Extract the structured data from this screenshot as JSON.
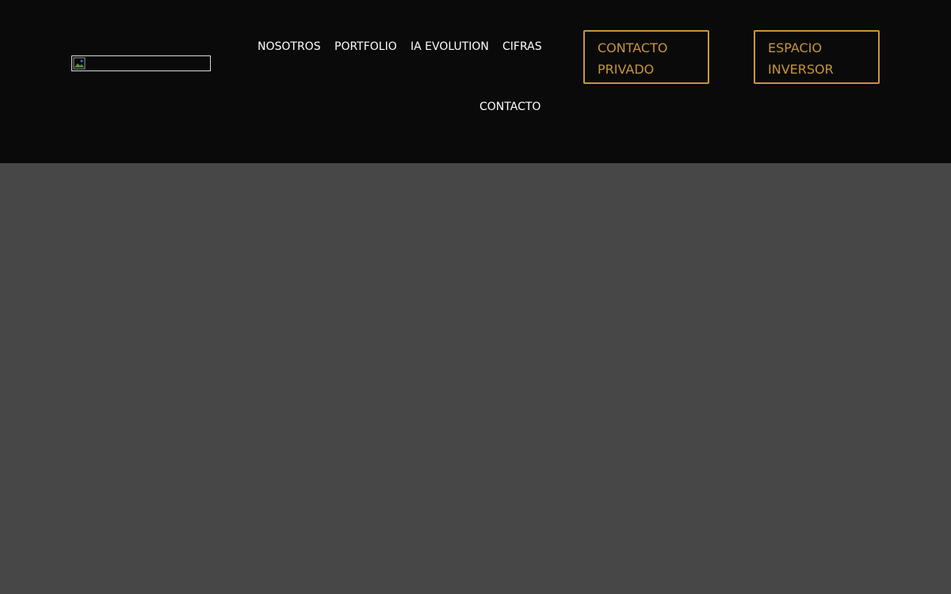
{
  "header": {
    "logo_icon": "broken-image-icon",
    "nav": {
      "nosotros": "NOSOTROS",
      "portfolio": "PORTFOLIO",
      "ia_evolution": "IA EVOLUTION",
      "cifras": "CIFRAS",
      "contacto": "CONTACTO"
    },
    "buttons": {
      "contacto_privado": "CONTACTO PRIVADO",
      "espacio_inversor": "ESPACIO INVERSOR"
    }
  },
  "colors": {
    "header_bg": "#0a0a0a",
    "page_bg": "#474747",
    "accent": "#c7953b",
    "nav_text": "#ffffff"
  }
}
